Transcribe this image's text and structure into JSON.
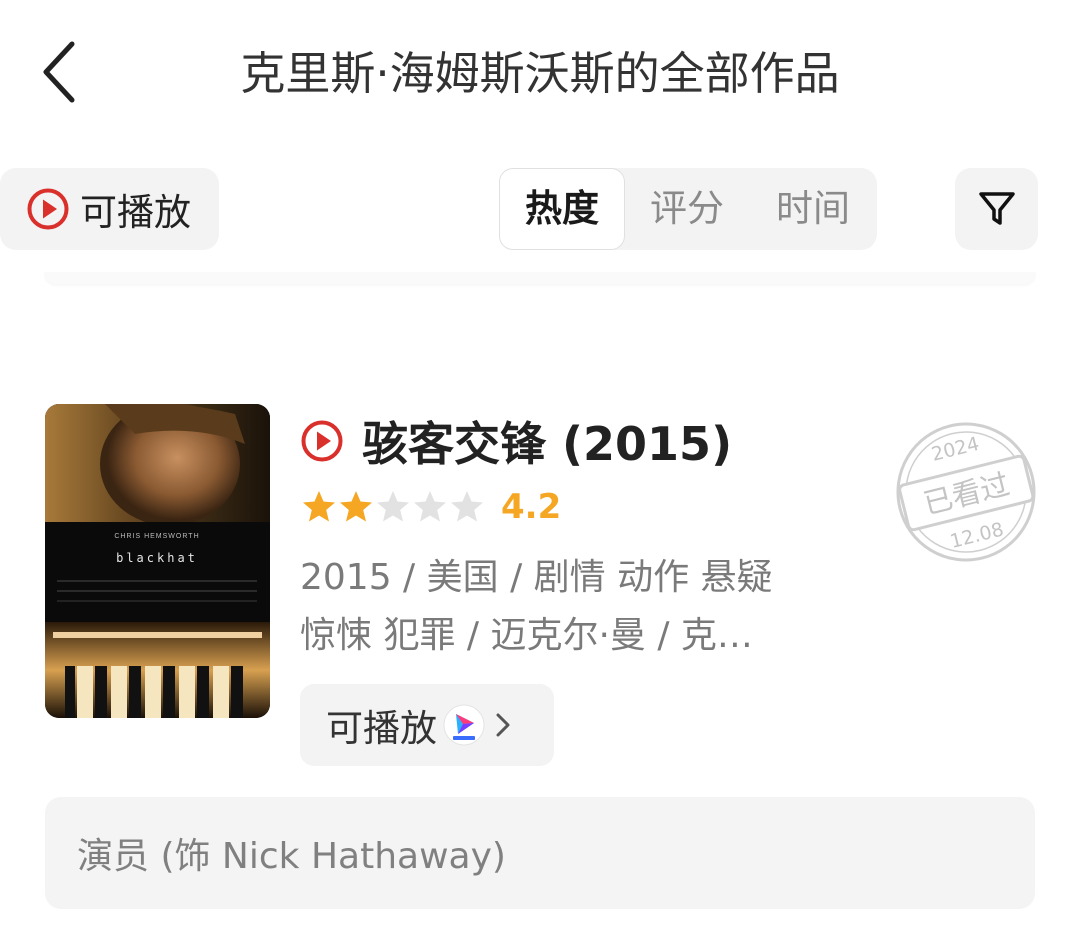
{
  "header": {
    "title": "克里斯·海姆斯沃斯的全部作品"
  },
  "toolbar": {
    "playable_label": "可播放",
    "sort_tabs": [
      {
        "label": "热度",
        "active": true
      },
      {
        "label": "评分",
        "active": false
      },
      {
        "label": "时间",
        "active": false
      }
    ]
  },
  "movie": {
    "title": "骇客交锋 (2015)",
    "rating": 4.2,
    "rating_text": "4.2",
    "stars": 2,
    "stars_total": 5,
    "meta_line1": "2015 / 美国 / 剧情 动作 悬疑",
    "meta_line2": "惊悚 犯罪 / 迈克尔·曼 / 克…",
    "play_label": "可播放",
    "platform": "youku",
    "poster": {
      "actor_credit": "CHRIS HEMSWORTH",
      "title_text": "blackhat"
    },
    "stamp": {
      "year": "2024",
      "label": "已看过",
      "date": "12.08"
    },
    "role": "演员 (饰 Nick Hathaway)"
  },
  "colors": {
    "accent_red": "#d9302c",
    "star_gold": "#f5a623",
    "star_gray": "#e2e2e2",
    "pill_bg": "#f3f3f3"
  },
  "icons": {
    "back": "chevron-left-icon",
    "play": "play-circle-icon",
    "filter": "funnel-icon",
    "chevron": "chevron-right-icon"
  }
}
